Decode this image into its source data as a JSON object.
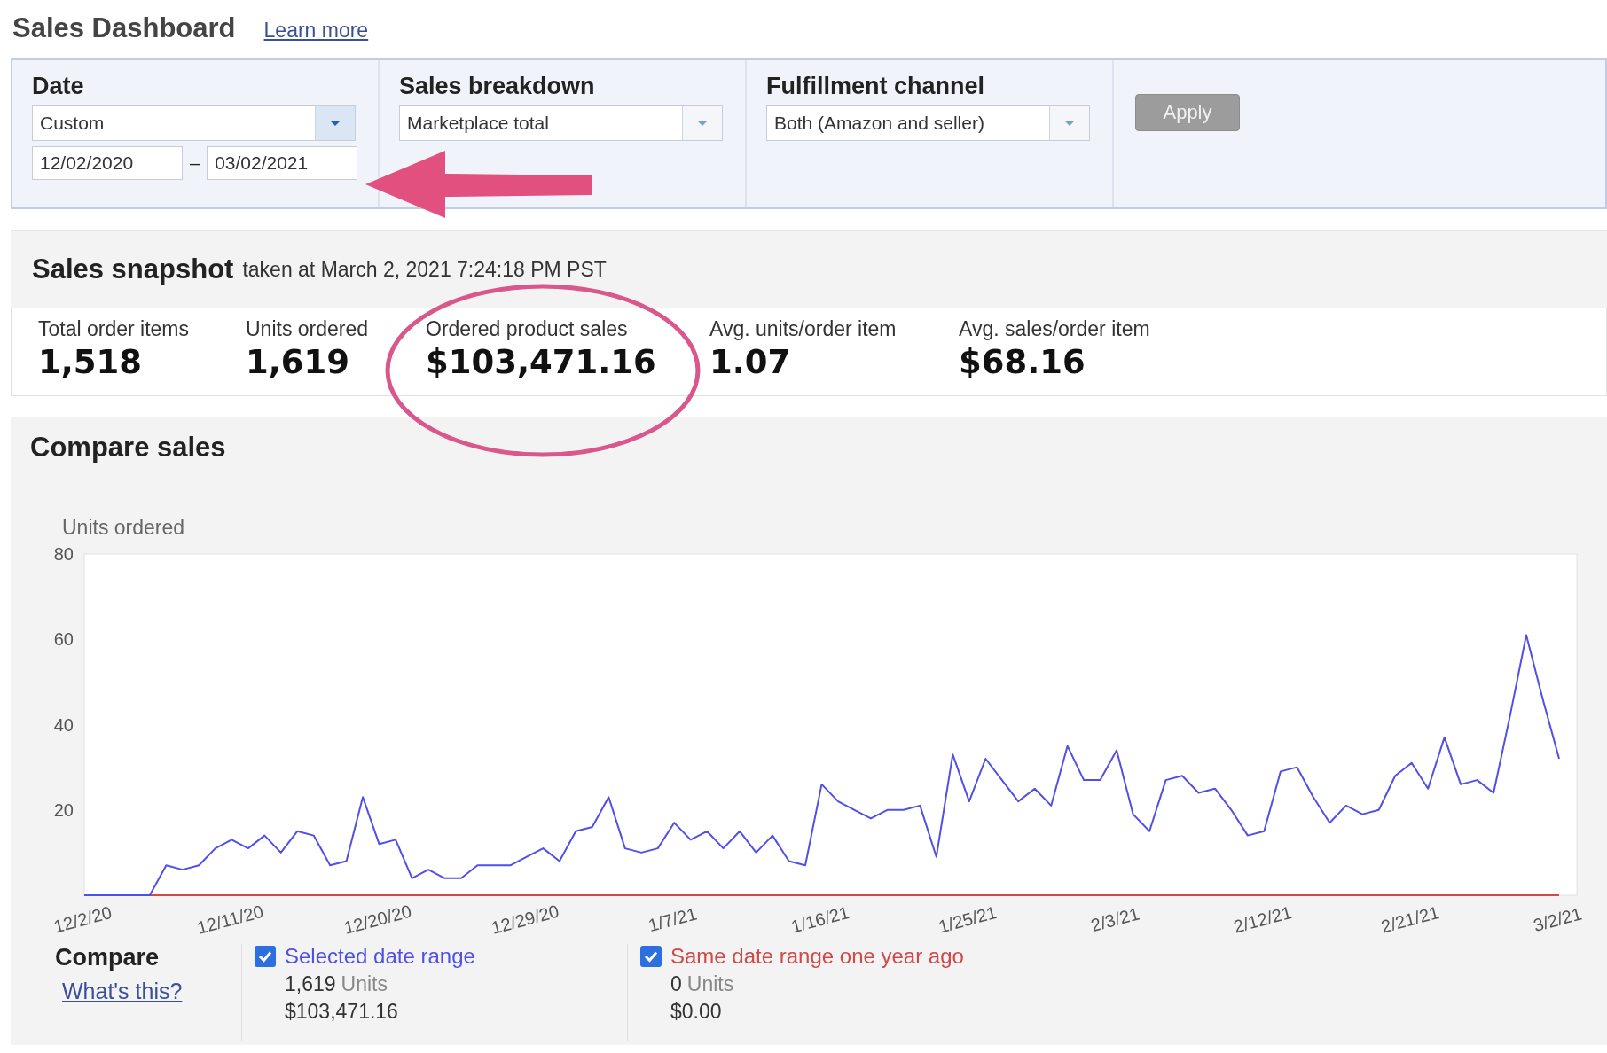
{
  "header": {
    "title": "Sales Dashboard",
    "link": "Learn more"
  },
  "filters": [
    {
      "label": "Date",
      "kind": "date",
      "value": "Custom",
      "from": "12/02/2020",
      "separator": "–",
      "to": "03/02/2021"
    },
    {
      "label": "Sales breakdown",
      "kind": "select",
      "value": "Marketplace total"
    },
    {
      "label": "Fulfillment channel",
      "kind": "select",
      "value": "Both (Amazon and seller)"
    }
  ],
  "apply_button": {
    "label": "Apply",
    "disabled": true
  },
  "snapshot": {
    "title": "Sales snapshot",
    "subtitle": "taken at March 2, 2021 7:24:18 PM PST",
    "metrics": [
      {
        "label": "Total order items",
        "value": "1,518"
      },
      {
        "label": "Units ordered",
        "value": "1,619"
      },
      {
        "label": "Ordered product sales",
        "value": "$103,471.16"
      },
      {
        "label": "Avg. units/order item",
        "value": "1.07"
      },
      {
        "label": "Avg. sales/order item",
        "value": "$68.16"
      }
    ]
  },
  "compare_sales": {
    "title": "Compare sales",
    "chart_data": {
      "type": "line",
      "ylabel": "Units ordered",
      "ylim": [
        0,
        80
      ],
      "yticks": [
        20,
        40,
        60,
        80
      ],
      "categories": [
        "12/2/20",
        null,
        null,
        null,
        null,
        null,
        null,
        null,
        null,
        "12/11/20",
        null,
        null,
        null,
        null,
        null,
        null,
        null,
        null,
        "12/20/20",
        null,
        null,
        null,
        null,
        null,
        null,
        null,
        null,
        "12/29/20",
        null,
        null,
        null,
        null,
        null,
        null,
        null,
        null,
        "1/7/21",
        null,
        null,
        null,
        null,
        null,
        null,
        null,
        null,
        "1/16/21",
        null,
        null,
        null,
        null,
        null,
        null,
        null,
        null,
        "1/25/21",
        null,
        null,
        null,
        null,
        null,
        null,
        null,
        null,
        "2/3/21",
        null,
        null,
        null,
        null,
        null,
        null,
        null,
        null,
        "2/12/21",
        null,
        null,
        null,
        null,
        null,
        null,
        null,
        null,
        "2/21/21",
        null,
        null,
        null,
        null,
        null,
        null,
        null,
        null,
        "3/2/21"
      ],
      "series": [
        {
          "name": "Same date range one year ago",
          "color": "#d04848",
          "values": [
            null,
            null,
            null,
            null,
            0,
            0,
            0,
            0,
            0,
            0,
            0,
            0,
            0,
            0,
            0,
            0,
            0,
            0,
            0,
            0,
            0,
            0,
            0,
            0,
            0,
            0,
            0,
            0,
            0,
            0,
            0,
            0,
            0,
            0,
            0,
            0,
            0,
            0,
            0,
            0,
            0,
            0,
            0,
            0,
            0,
            0,
            0,
            0,
            0,
            0,
            0,
            0,
            0,
            0,
            0,
            0,
            0,
            0,
            0,
            0,
            0,
            0,
            0,
            0,
            0,
            0,
            0,
            0,
            0,
            0,
            0,
            0,
            0,
            0,
            0,
            0,
            0,
            0,
            0,
            0,
            0,
            0,
            0,
            0,
            0,
            0,
            0,
            0,
            0,
            0,
            0
          ]
        },
        {
          "name": "Selected date range",
          "color": "#5050e8",
          "values": [
            0,
            0,
            0,
            0,
            0,
            7,
            6,
            7,
            11,
            13,
            11,
            14,
            10,
            15,
            14,
            7,
            8,
            23,
            12,
            13,
            4,
            6,
            4,
            4,
            7,
            7,
            7,
            9,
            11,
            8,
            15,
            16,
            23,
            11,
            10,
            11,
            17,
            13,
            15,
            11,
            15,
            10,
            14,
            8,
            7,
            26,
            22,
            20,
            18,
            20,
            20,
            21,
            9,
            33,
            22,
            32,
            27,
            22,
            25,
            21,
            35,
            27,
            27,
            34,
            19,
            15,
            27,
            28,
            24,
            25,
            20,
            14,
            15,
            29,
            30,
            23,
            17,
            21,
            19,
            20,
            28,
            31,
            25,
            37,
            26,
            27,
            24,
            42,
            61,
            46,
            32
          ]
        }
      ]
    }
  },
  "compare": {
    "title": "Compare",
    "link": "What's this?",
    "series": [
      {
        "checked": true,
        "units_value": "1,619",
        "units_label": "Units",
        "sales": "$103,471.16"
      },
      {
        "checked": true,
        "units_value": "0",
        "units_label": "Units",
        "sales": "$0.00"
      }
    ]
  }
}
